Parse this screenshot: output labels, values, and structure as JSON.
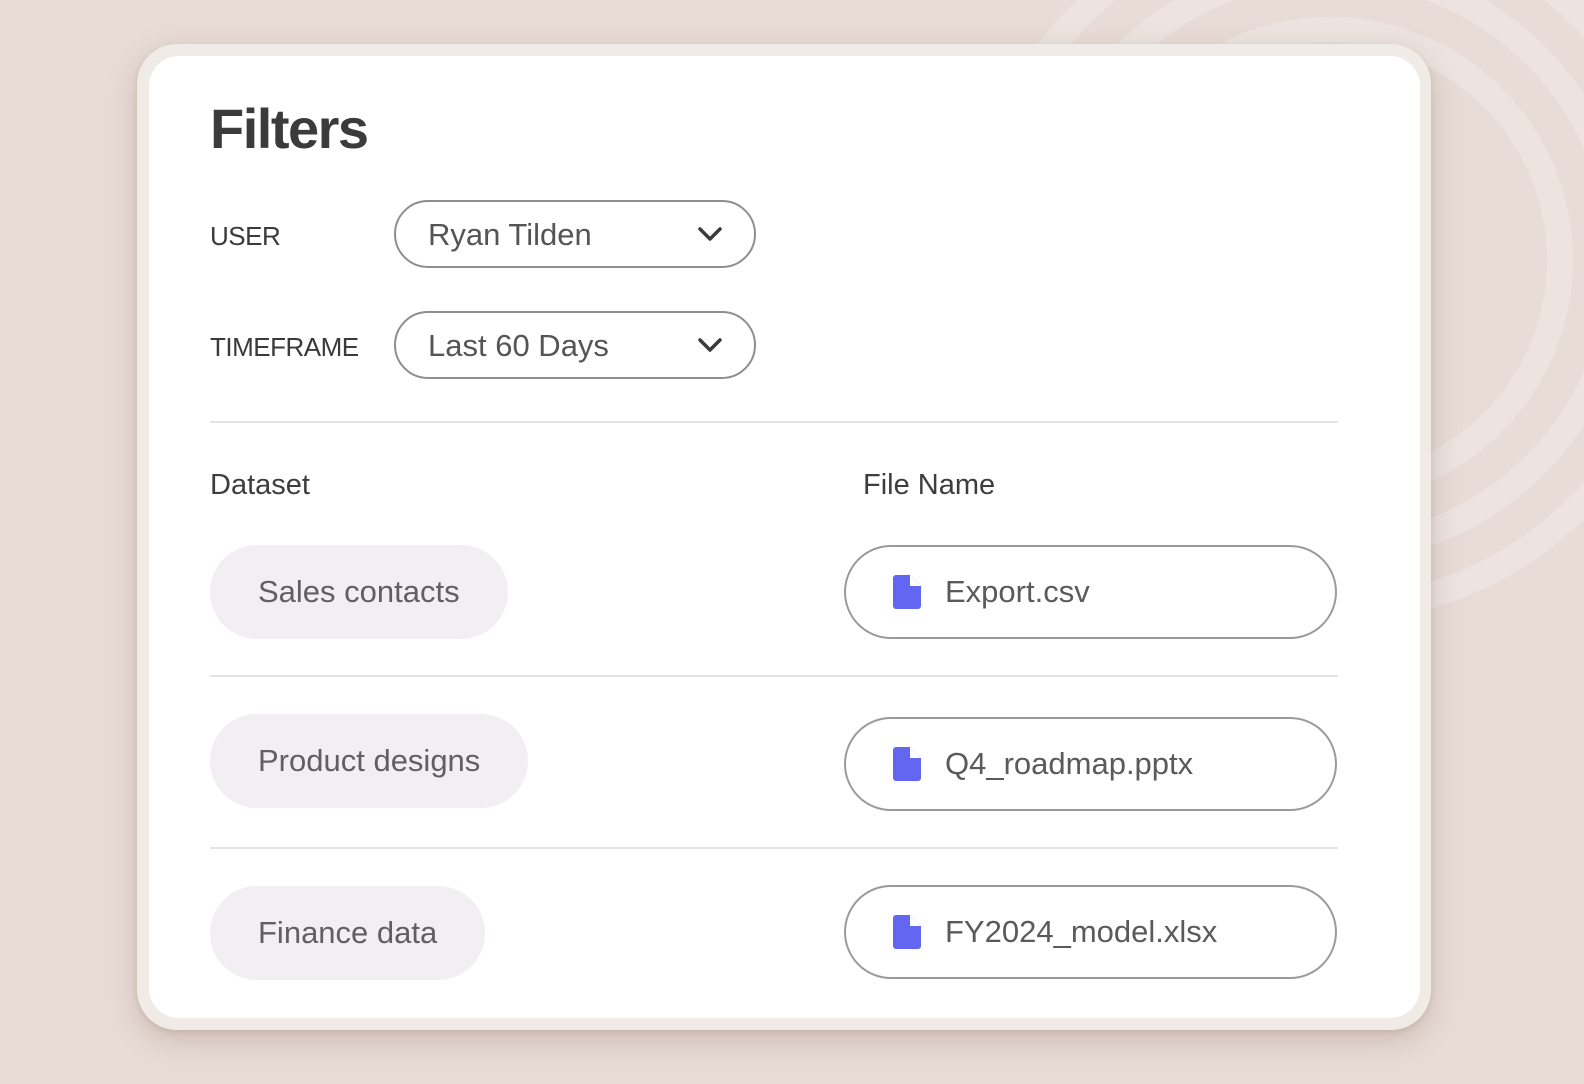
{
  "colors": {
    "background": "#e8dcd6",
    "card": "#ffffff",
    "file_icon": "#6366f1",
    "dataset_pill": "#f1eff1"
  },
  "panel": {
    "title": "Filters"
  },
  "filters": {
    "user": {
      "label": "USER",
      "value": "Ryan Tilden",
      "icon": "chevron-down-icon"
    },
    "timeframe": {
      "label": "TIMEFRAME",
      "value": "Last 60 Days",
      "icon": "chevron-down-icon"
    }
  },
  "table": {
    "headers": {
      "dataset": "Dataset",
      "file_name": "File Name"
    },
    "rows": [
      {
        "dataset": "Sales contacts",
        "file_name": "Export.csv",
        "file_icon": "document-icon"
      },
      {
        "dataset": "Product designs",
        "file_name": "Q4_roadmap.pptx",
        "file_icon": "document-icon"
      },
      {
        "dataset": "Finance data",
        "file_name": "FY2024_model.xlsx",
        "file_icon": "document-icon"
      }
    ]
  }
}
